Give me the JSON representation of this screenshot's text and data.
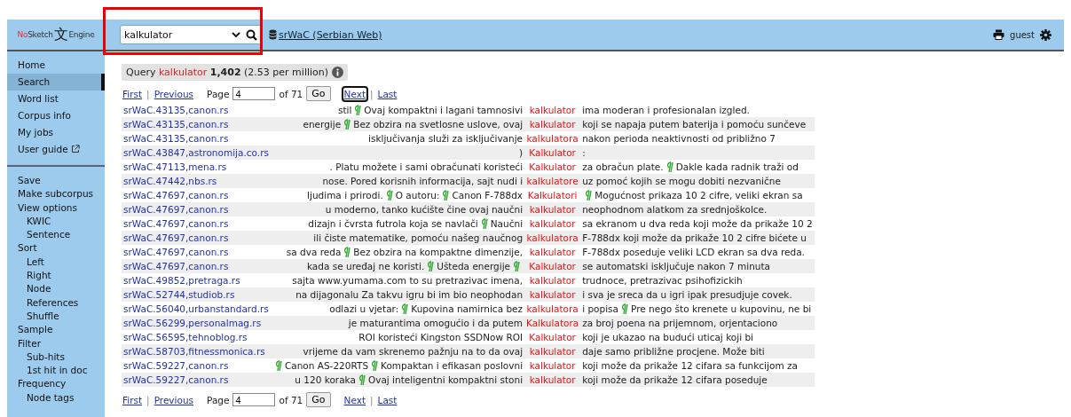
{
  "header": {
    "logo": {
      "prefix": "No",
      "name": "Sketch",
      "glyph": "文",
      "suffix": "Engine"
    },
    "search": {
      "value": "kalkulator",
      "highlighted": true
    },
    "corpus": "srWaC (Serbian Web)",
    "user": "guest"
  },
  "sidebar": {
    "groups": [
      {
        "items": [
          {
            "label": "Home",
            "selected": false
          },
          {
            "label": "Search",
            "selected": true
          },
          {
            "label": "Word list",
            "selected": false
          },
          {
            "label": "Corpus info",
            "selected": false
          },
          {
            "label": "My jobs",
            "selected": false
          },
          {
            "label": "User guide",
            "selected": false,
            "external": true
          }
        ]
      },
      {
        "items": [
          {
            "label": "Save",
            "selected": false
          },
          {
            "label": "Make subcorpus",
            "selected": false
          },
          {
            "label": "View options",
            "selected": false,
            "children": [
              {
                "label": "KWIC",
                "selected": false
              },
              {
                "label": "Sentence",
                "selected": false
              }
            ]
          },
          {
            "label": "Sort",
            "selected": false,
            "children": [
              {
                "label": "Left",
                "selected": false
              },
              {
                "label": "Right",
                "selected": false
              },
              {
                "label": "Node",
                "selected": false
              },
              {
                "label": "References",
                "selected": false
              },
              {
                "label": "Shuffle",
                "selected": false
              }
            ]
          },
          {
            "label": "Sample",
            "selected": false
          },
          {
            "label": "Filter",
            "selected": false,
            "children": [
              {
                "label": "Sub-hits",
                "selected": false
              },
              {
                "label": "1st hit in doc",
                "selected": false
              }
            ]
          },
          {
            "label": "Frequency",
            "selected": false,
            "children": [
              {
                "label": "Node tags",
                "selected": false
              }
            ]
          }
        ]
      }
    ]
  },
  "query": {
    "label": "Query",
    "query": "kalkulator",
    "hits": "1,402",
    "relative": "(2.53 per million)"
  },
  "pagers": [
    {
      "first": "First",
      "sep1": "|",
      "previous": "Previous",
      "page_label": "Page",
      "page": "4",
      "of": "of 71",
      "go": "Go",
      "next": "Next",
      "sep2": "|",
      "last": "Last",
      "next_focused": true
    },
    {
      "first": "First",
      "sep1": "|",
      "previous": "Previous",
      "page_label": "Page",
      "page": "4",
      "of": "of 71",
      "go": "Go",
      "next": "Next",
      "sep2": "|",
      "last": "Last",
      "next_focused": false
    }
  ],
  "concordance": [
    {
      "ref": "srWaC.43135,canon.rs",
      "left": [
        "stil",
        {
          "kind": "mark"
        },
        "Ovaj kompaktni i lagani tamnosivi"
      ],
      "kwic": "kalkulator",
      "right": [
        "ima moderan i profesionalan izgled."
      ]
    },
    {
      "ref": "srWaC.43135,canon.rs",
      "left": [
        "energije",
        {
          "kind": "mark"
        },
        "Bez obzira na svetlosne uslove, ovaj"
      ],
      "kwic": "kalkulator",
      "right": [
        "koji se napaja putem baterija i pomoću sunčeve"
      ]
    },
    {
      "ref": "srWaC.43135,canon.rs",
      "left": [
        "isključivanja služi za isključivanje"
      ],
      "kwic": "kalkulatora",
      "right": [
        "nakon perioda neaktivnosti od približno 7"
      ]
    },
    {
      "ref": "srWaC.43847,astronomija.co.rs",
      "left": [
        ")"
      ],
      "kwic": "Kalkulator",
      "right": [
        ":"
      ]
    },
    {
      "ref": "srWaC.47113,mena.rs",
      "left": [
        ". Platu možete i sami obračunati koristeći"
      ],
      "kwic": "Kalkulator",
      "right": [
        "za obračun plate.",
        {
          "kind": "mark"
        },
        "Dakle kada radnik traži od"
      ]
    },
    {
      "ref": "srWaC.47442,nbs.rs",
      "left": [
        "nose. Pored korisnih informacija, sajt nudi i"
      ],
      "kwic": "kalkulatore",
      "right": [
        "uz pomoć kojih se mogu dobiti nezvanične"
      ]
    },
    {
      "ref": "srWaC.47697,canon.rs",
      "left": [
        "ljudima i prirodi.",
        {
          "kind": "mark"
        },
        "O autoru:",
        {
          "kind": "mark"
        },
        "Canon F-788dx"
      ],
      "kwic": "Kalkulatori",
      "right": [
        {
          "kind": "mark"
        },
        "Mogućnost prikaza 10 2 cifre, veliki ekran sa"
      ]
    },
    {
      "ref": "srWaC.47697,canon.rs",
      "left": [
        "u moderno, tanko kućište čine ovaj naučni"
      ],
      "kwic": "kalkulator",
      "right": [
        "neophodnom alatkom za srednjoškolce."
      ]
    },
    {
      "ref": "srWaC.47697,canon.rs",
      "left": [
        "dizajn i čvrsta futrola koja se navlači",
        {
          "kind": "mark"
        },
        "Naučni"
      ],
      "kwic": "kalkulator",
      "right": [
        "sa ekranom u dva reda koji može da prikaže 10 2"
      ]
    },
    {
      "ref": "srWaC.47697,canon.rs",
      "left": [
        "ili čiste matematike, pomoću našeg naučnog"
      ],
      "kwic": "kalkulatora",
      "right": [
        "F-788dx koji može da prikaže 10 2 cifre bićete u"
      ]
    },
    {
      "ref": "srWaC.47697,canon.rs",
      "left": [
        "sa dva reda",
        {
          "kind": "mark"
        },
        "Bez obzira na kompaktne dimenzije,"
      ],
      "kwic": "kalkulator",
      "right": [
        "F-788dx poseduje veliki LCD ekran sa dva reda."
      ]
    },
    {
      "ref": "srWaC.47697,canon.rs",
      "left": [
        "kada se uređaj ne koristi.",
        {
          "kind": "mark"
        },
        "Ušteda energije",
        {
          "kind": "mark"
        }
      ],
      "kwic": "Kalkulator",
      "right": [
        "se automatski isključuje nakon 7 minuta"
      ]
    },
    {
      "ref": "srWaC.49852,pretraga.rs",
      "left": [
        "sajta www.yumama.com to su pretrazivac imena,"
      ],
      "kwic": "kalkulator",
      "right": [
        "trudnoce, pretrazivac psihofizickih"
      ]
    },
    {
      "ref": "srWaC.52744,studiob.rs",
      "left": [
        "na dijagonalu Za takvu igru bi im bio neophodan"
      ],
      "kwic": "kalkulator",
      "right": [
        "i sva je sreca da u igri ipak presudjuje covek."
      ]
    },
    {
      "ref": "srWaC.56040,urbanstandard.rs",
      "left": [
        "odlazi u vjetar:",
        {
          "kind": "mark"
        },
        "Kupovina namirnica bez"
      ],
      "kwic": "kalkulatora",
      "right": [
        "i popisa",
        {
          "kind": "mark"
        },
        "Pre nego što krenete u kupovinu, ne bi"
      ]
    },
    {
      "ref": "srWaC.56299,personalmag.rs",
      "left": [
        "je maturantima omogućio i da putem"
      ],
      "kwic": "Kalkulatora",
      "right": [
        "za broj poena na prijemnom, orjentaciono"
      ]
    },
    {
      "ref": "srWaC.56595,tehnoblog.rs",
      "left": [
        "ROI koristeći Kingston SSDNow ROI"
      ],
      "kwic": "Kalkulator",
      "right": [
        "koji je ukazao na budući uticaj koji bi"
      ]
    },
    {
      "ref": "srWaC.58703,fitnessmonica.rs",
      "left": [
        "vrijeme da vam skrenemo pažnju na to da ovaj"
      ],
      "kwic": "kalkulator",
      "right": [
        "daje samo približne procjene. Može biti"
      ]
    },
    {
      "ref": "srWaC.59227,canon.rs",
      "left": [
        {
          "kind": "mark"
        },
        "Canon AS-220RTS",
        {
          "kind": "mark"
        },
        "Kompaktan i efikasan poslovni"
      ],
      "kwic": "kalkulator",
      "right": [
        "koji može da prikaže 12 cifara sa funkcijom za"
      ]
    },
    {
      "ref": "srWaC.59227,canon.rs",
      "left": [
        "u 120 koraka",
        {
          "kind": "mark"
        },
        "Ovaj inteligentni kompaktni stoni"
      ],
      "kwic": "kalkulator",
      "right": [
        "koji može da prikaže 12 cifara poseduje"
      ]
    }
  ]
}
